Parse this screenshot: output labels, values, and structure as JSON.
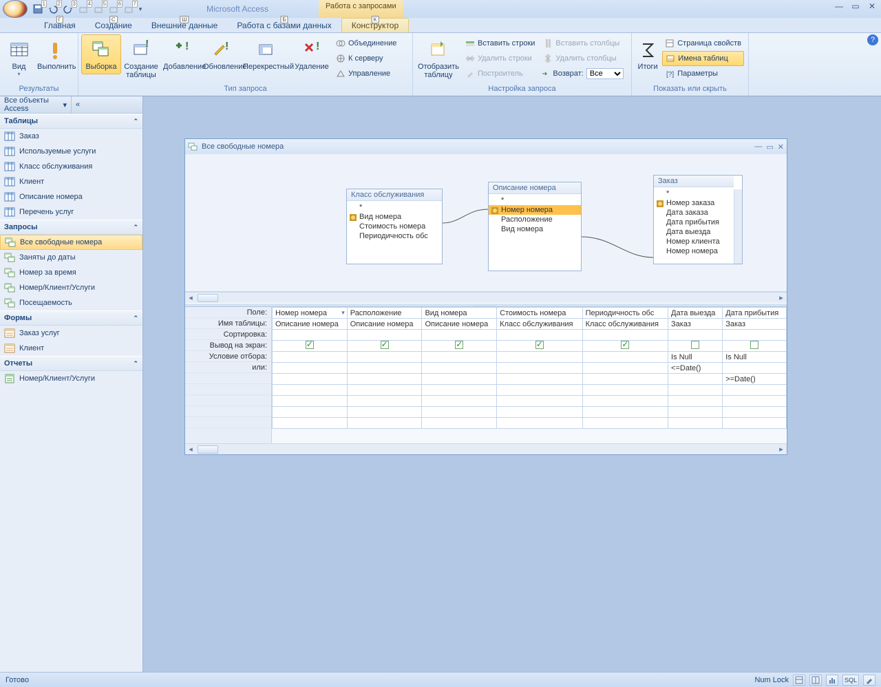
{
  "app_title": "Microsoft Access",
  "context_tab_group": "Работа с запросами",
  "qat_numbers": [
    "1",
    "2",
    "3",
    "4",
    "5",
    "6",
    "7"
  ],
  "tabs": {
    "home": "Главная",
    "home_key": "Г",
    "create": "Создание",
    "create_key": "С",
    "external": "Внешние данные",
    "external_key": "Ш",
    "dbtools": "Работа с базами данных",
    "dbtools_key": "Б",
    "designer": "Конструктор",
    "designer_key": "К"
  },
  "ribbon": {
    "results": {
      "view": "Вид",
      "run": "Выполнить",
      "label": "Результаты"
    },
    "query_type": {
      "select": "Выборка",
      "make_table": "Создание таблицы",
      "append": "Добавление",
      "update": "Обновление",
      "crosstab": "Перекрестный",
      "delete": "Удаление",
      "union": "Объединение",
      "passthrough": "К серверу",
      "data_def": "Управление",
      "label": "Тип запроса"
    },
    "setup": {
      "show_table": "Отобразить таблицу",
      "insert_rows": "Вставить строки",
      "delete_rows": "Удалить строки",
      "builder": "Построитель",
      "insert_cols": "Вставить столбцы",
      "delete_cols": "Удалить столбцы",
      "return": "Возврат:",
      "return_value": "Все",
      "label": "Настройка запроса"
    },
    "showhide": {
      "totals": "Итоги",
      "prop_sheet": "Страница свойств",
      "table_names": "Имена таблиц",
      "parameters": "Параметры",
      "label": "Показать или скрыть"
    }
  },
  "nav": {
    "header": "Все объекты Access",
    "groups": {
      "tables": "Таблицы",
      "queries": "Запросы",
      "forms": "Формы",
      "reports": "Отчеты"
    },
    "tables": [
      "Заказ",
      "Используемые услуги",
      "Класс обслуживания",
      "Клиент",
      "Описание номера",
      "Перечень услуг"
    ],
    "queries": [
      "Все свободные номера",
      "Заняты до даты",
      "Номер за время",
      "Номер/Клиент/Услуги",
      "Посещаемость"
    ],
    "forms": [
      "Заказ услуг",
      "Клиент"
    ],
    "reports": [
      "Номер/Клиент/Услуги"
    ]
  },
  "child_window": {
    "title": "Все свободные номера",
    "diagram": {
      "t1": {
        "title": "Класс обслуживания",
        "rows": [
          "*",
          "Вид номера",
          "Стоимость номера",
          "Периодичность обс"
        ]
      },
      "t2": {
        "title": "Описание номера",
        "rows": [
          "*",
          "Номер номера",
          "Расположение",
          "Вид номера"
        ]
      },
      "t3": {
        "title": "Заказ",
        "rows": [
          "*",
          "Номер заказа",
          "Дата заказа",
          "Дата прибытия",
          "Дата выезда",
          "Номер клиента",
          "Номер номера"
        ]
      }
    },
    "grid_labels": [
      "Поле:",
      "Имя таблицы:",
      "Сортировка:",
      "Вывод на экран:",
      "Условие отбора:",
      "или:"
    ],
    "grid": [
      {
        "field": "Номер номера",
        "table": "Описание номера",
        "show": true,
        "crit": "",
        "or": ""
      },
      {
        "field": "Расположение",
        "table": "Описание номера",
        "show": true,
        "crit": "",
        "or": ""
      },
      {
        "field": "Вид номера",
        "table": "Описание номера",
        "show": true,
        "crit": "",
        "or": ""
      },
      {
        "field": "Стоимость номера",
        "table": "Класс обслуживания",
        "show": true,
        "crit": "",
        "or": ""
      },
      {
        "field": "Периодичность обс",
        "table": "Класс обслуживания",
        "show": true,
        "crit": "",
        "or": ""
      },
      {
        "field": "Дата выезда",
        "table": "Заказ",
        "show": false,
        "crit": "Is Null",
        "or": "<=Date()"
      },
      {
        "field": "Дата прибытия",
        "table": "Заказ",
        "show": false,
        "crit": "Is Null",
        "or": ">=Date()",
        "or_row": 2
      }
    ]
  },
  "status": {
    "ready": "Готово",
    "numlock": "Num Lock",
    "sql": "SQL"
  }
}
